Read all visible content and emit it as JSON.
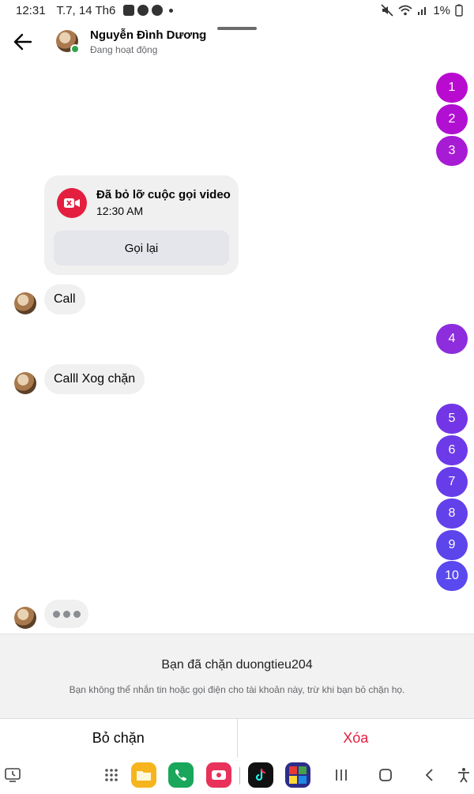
{
  "status_bar": {
    "time": "12:31",
    "date": "T.7, 14 Th6",
    "battery": "1%"
  },
  "header": {
    "contact_name": "Nguyễn Đình Dương",
    "presence": "Đang hoạt động"
  },
  "messages": {
    "outgoing_top": [
      "1",
      "2",
      "3"
    ],
    "missed_call": {
      "title": "Đã bỏ lỡ cuộc gọi video",
      "time": "12:30 AM",
      "callback_label": "Gọi lại"
    },
    "incoming_1": "Call",
    "outgoing_mid": [
      "4"
    ],
    "incoming_2": "Calll Xog chặn",
    "outgoing_bottom": [
      "5",
      "6",
      "7",
      "8",
      "9",
      "10"
    ]
  },
  "blocked_notice": {
    "title": "Bạn đã chặn duongtieu204",
    "subtitle": "Bạn không thể nhắn tin hoặc gọi điện cho tài khoản này, trừ khi bạn bỏ chặn họ."
  },
  "actions": {
    "unblock_label": "Bỏ chặn",
    "delete_label": "Xóa"
  },
  "colors": {
    "outgoing_gradient": [
      "#b90bd0",
      "#9c2adf",
      "#6a3ce8",
      "#5b4bee"
    ],
    "missed_call_red": "#e41e3f",
    "online_green": "#31a24c"
  },
  "icons": {
    "back": "arrow-left-icon",
    "missed_call": "video-missed-icon",
    "nav": [
      "recent-apps-icon",
      "app-drawer-icon",
      "files-app-icon",
      "phone-app-icon",
      "screen-recorder-app-icon",
      "tiktok-app-icon",
      "game-app-icon",
      "recents-button-icon",
      "home-button-icon",
      "back-button-icon",
      "accessibility-icon"
    ]
  }
}
